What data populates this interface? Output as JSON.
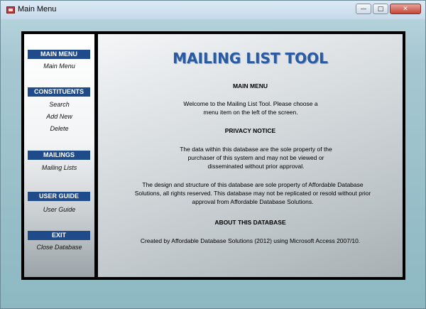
{
  "window": {
    "title": "Main Menu",
    "buttons": {
      "minimize": "—",
      "maximize": "□",
      "close": "✕"
    }
  },
  "sidebar": {
    "sections": [
      {
        "header": "MAIN MENU",
        "items": [
          "Main Menu"
        ]
      },
      {
        "header": "CONSTITUENTS",
        "items": [
          "Search",
          "Add New",
          "Delete"
        ]
      },
      {
        "header": "MAILINGS",
        "items": [
          "Mailing Lists"
        ]
      },
      {
        "header": "USER GUIDE",
        "items": [
          "User Guide"
        ]
      },
      {
        "header": "EXIT",
        "items": [
          "Close Database"
        ]
      }
    ]
  },
  "content": {
    "title": "MAILING LIST TOOL",
    "main_menu_heading": "MAIN MENU",
    "welcome_text": "Welcome to the Mailing List Tool.  Please choose a menu item on the left of the screen.",
    "privacy_heading": "PRIVACY NOTICE",
    "privacy_text_1": "The data within this database are the sole property of the purchaser of this system and may not be viewed or disseminated without prior approval.",
    "privacy_text_2": "The design and structure of this database are sole property of Affordable Database Solutions, all rights reserved.  This database may not be replicated or resold without prior approval from Affordable Database Solutions.",
    "about_heading": "ABOUT THIS DATABASE",
    "about_text": "Created by Affordable Database Solutions (2012) using Microsoft Access 2007/10."
  },
  "colors": {
    "header_blue": "#1f4b8a",
    "title_blue": "#2a5aa0",
    "frame": "#000000",
    "background_teal": "#8db8c2"
  },
  "icons": [
    "access-form-icon",
    "minimize-icon",
    "maximize-icon",
    "close-icon"
  ]
}
